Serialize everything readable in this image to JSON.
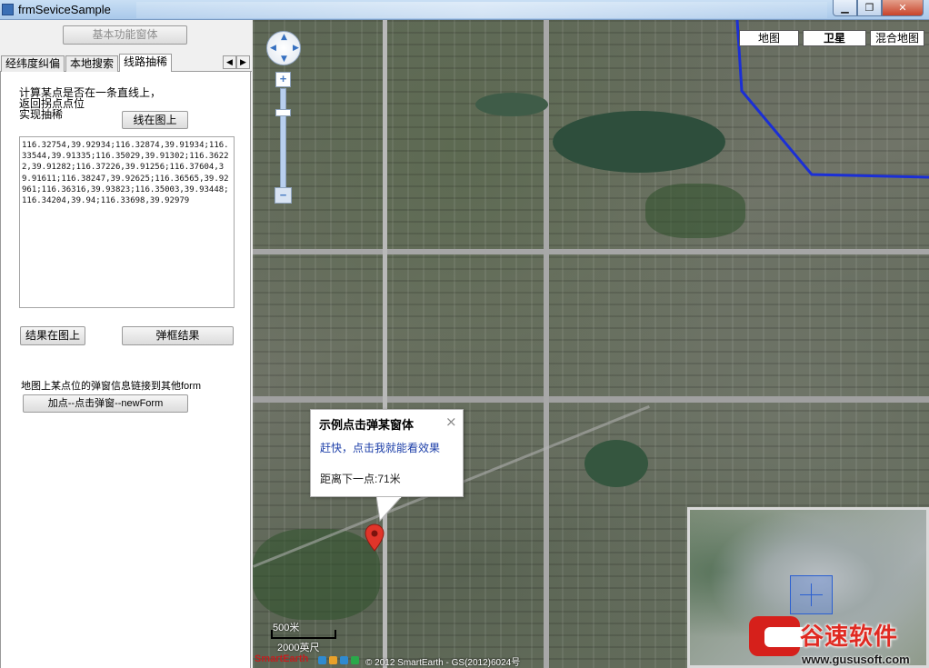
{
  "window": {
    "title": "frmSeviceSample",
    "minimize_glyph": "▁",
    "maximize_glyph": "❐",
    "close_glyph": "✕"
  },
  "left_panel": {
    "basic_button": "基本功能窗体",
    "tabs": [
      {
        "label": "经纬度纠偏"
      },
      {
        "label": "本地搜索"
      },
      {
        "label": "线路抽稀"
      }
    ],
    "tab_scroll_left": "◀",
    "tab_scroll_right": "▶",
    "calc_label": "计算某点是否在一条直线上，\n返回拐点点位\n实现抽稀",
    "line_on_map_button": "线在图上",
    "coordinates_text": "116.32754,39.92934;116.32874,39.91934;116.33544,39.91335;116.35029,39.91302;116.36222,39.91282;116.37226,39.91256;116.37604,39.91611;116.38247,39.92625;116.36565,39.92961;116.36316,39.93823;116.35003,39.93448;116.34204,39.94;116.33698,39.92979",
    "result_on_map_button": "结果在图上",
    "popup_result_button": "弹框结果",
    "link_label": "地图上某点位的弹窗信息链接到其他form",
    "add_point_button": "加点--点击弹窗--newForm"
  },
  "map": {
    "map_type_buttons": {
      "map": "地图",
      "satellite": "卫星",
      "hybrid": "混合地图"
    },
    "zoom_in": "+",
    "zoom_out": "−",
    "popup": {
      "title": "示例点击弹某窗体",
      "close": "×",
      "link": "赶快，点击我就能看效果",
      "distance": "距离下一点:71米"
    },
    "scale": {
      "metric": "500米",
      "imperial": "2000英尺"
    },
    "brand": "SmartEarth",
    "copyright": "© 2012 SmartEarth - GS(2012)6024号",
    "accent_colors": {
      "route": "#1b2fd6",
      "marker": "#e0352a"
    }
  },
  "watermark": {
    "name": "谷速软件",
    "url": "www.gususoft.com"
  }
}
